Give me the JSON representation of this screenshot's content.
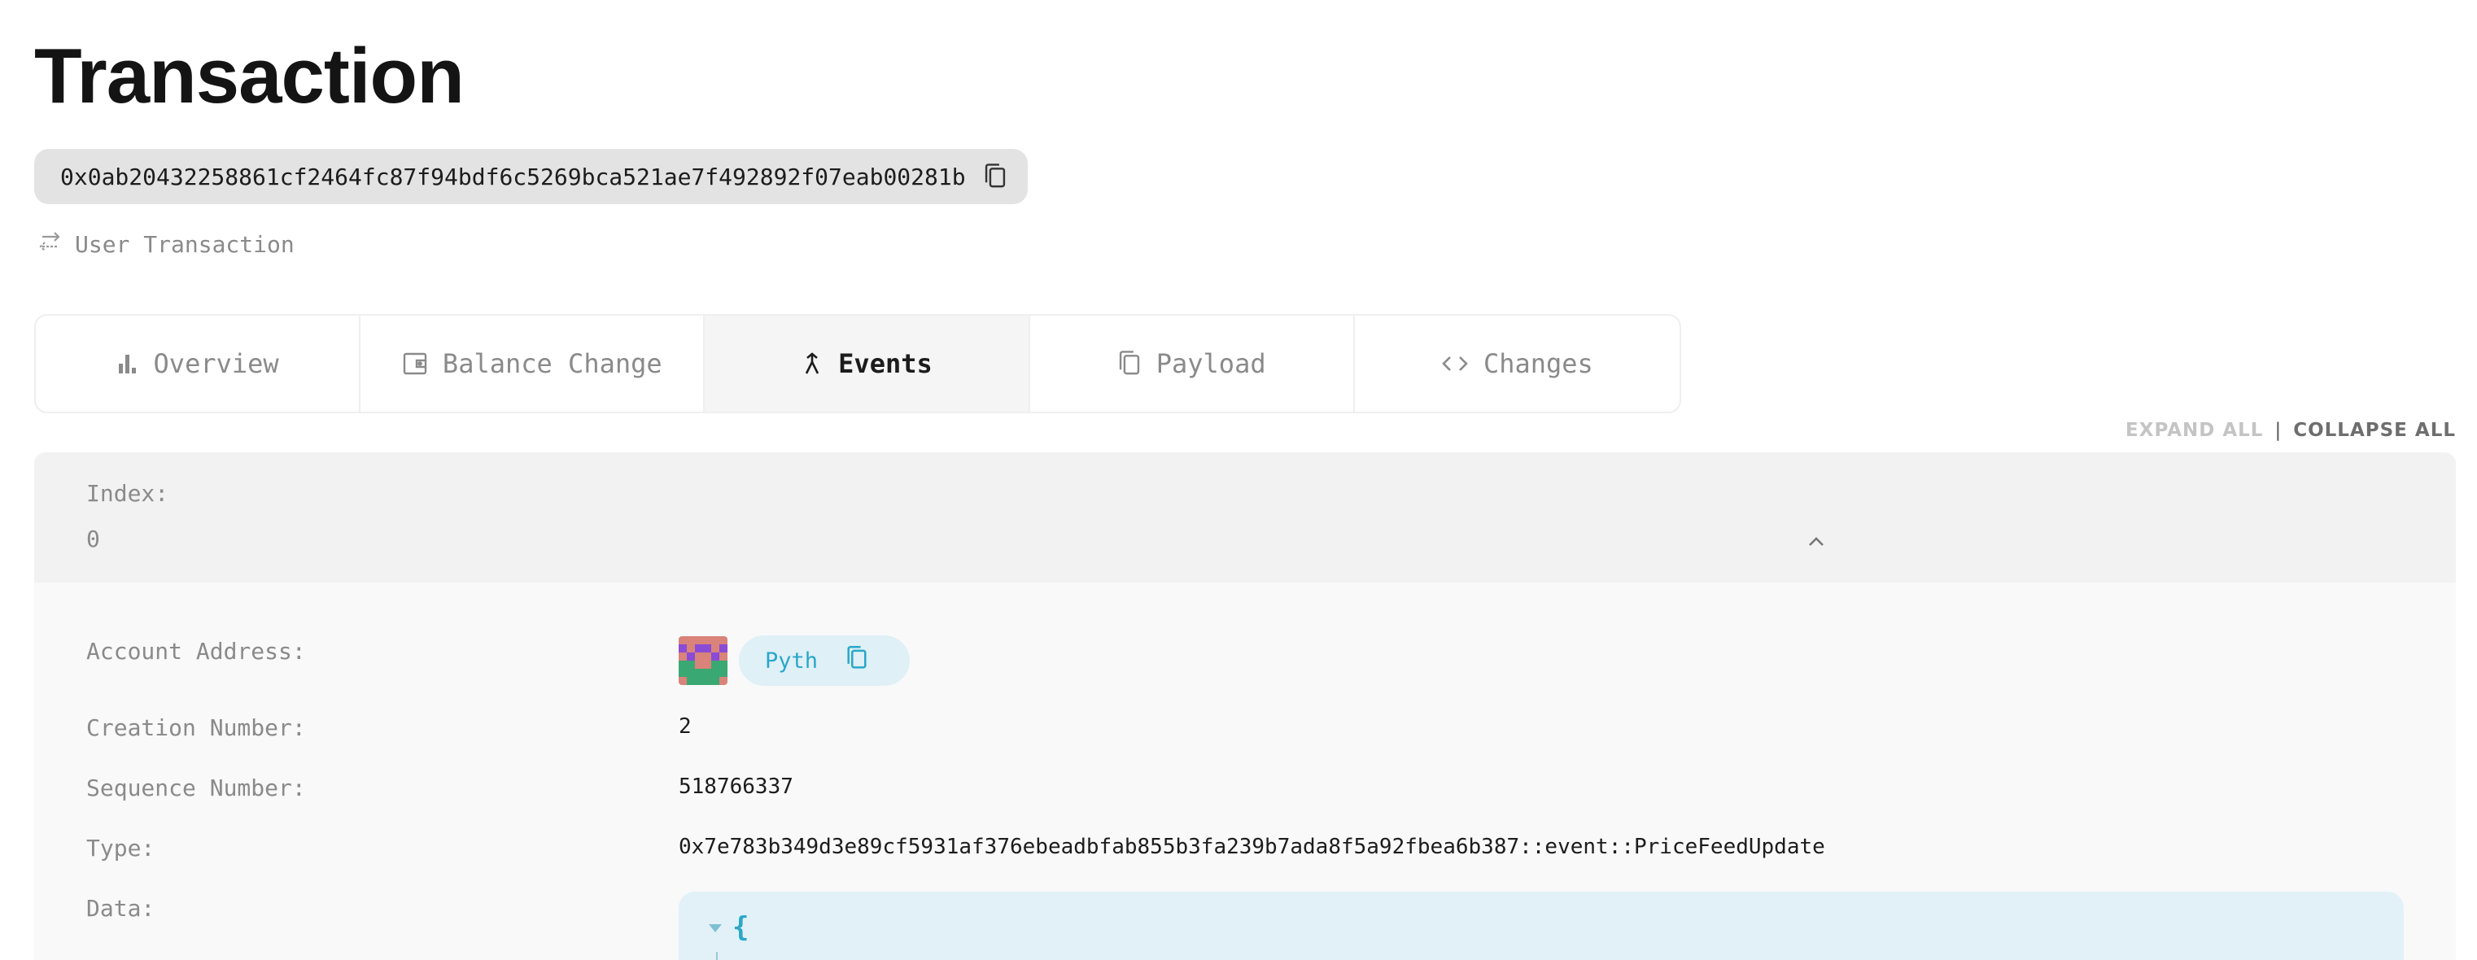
{
  "page": {
    "title": "Transaction",
    "hash": "0x0ab20432258861cf2464fc87f94bdf6c5269bca521ae7f492892f07eab00281b",
    "txn_type": "User Transaction"
  },
  "tabs": [
    {
      "label": "Overview",
      "icon": "bar-chart-icon",
      "active": false
    },
    {
      "label": "Balance Change",
      "icon": "wallet-icon",
      "active": false
    },
    {
      "label": "Events",
      "icon": "merge-icon",
      "active": true
    },
    {
      "label": "Payload",
      "icon": "copy-icon",
      "active": false
    },
    {
      "label": "Changes",
      "icon": "code-icon",
      "active": false
    }
  ],
  "controls": {
    "expand_all": "EXPAND ALL",
    "separator": "|",
    "collapse_all": "COLLAPSE ALL"
  },
  "event": {
    "index_label": "Index:",
    "index_value": "0",
    "account_address_label": "Account Address:",
    "account_name": "Pyth",
    "creation_number_label": "Creation Number:",
    "creation_number": "2",
    "sequence_number_label": "Sequence Number:",
    "sequence_number": "518766337",
    "type_label": "Type:",
    "type_value": "0x7e783b349d3e89cf5931af376ebeadbfab855b3fa239b7ada8f5a92fbea6b387::event::PriceFeedUpdate",
    "data_label": "Data:",
    "data_open": "{"
  },
  "colors": {
    "accent": "#2aa7c9",
    "chip_bg": "#dff0f6",
    "pill_bg": "#e3e3e3",
    "card_bg": "#f9f9f9",
    "header_bg": "#f2f2f2"
  }
}
